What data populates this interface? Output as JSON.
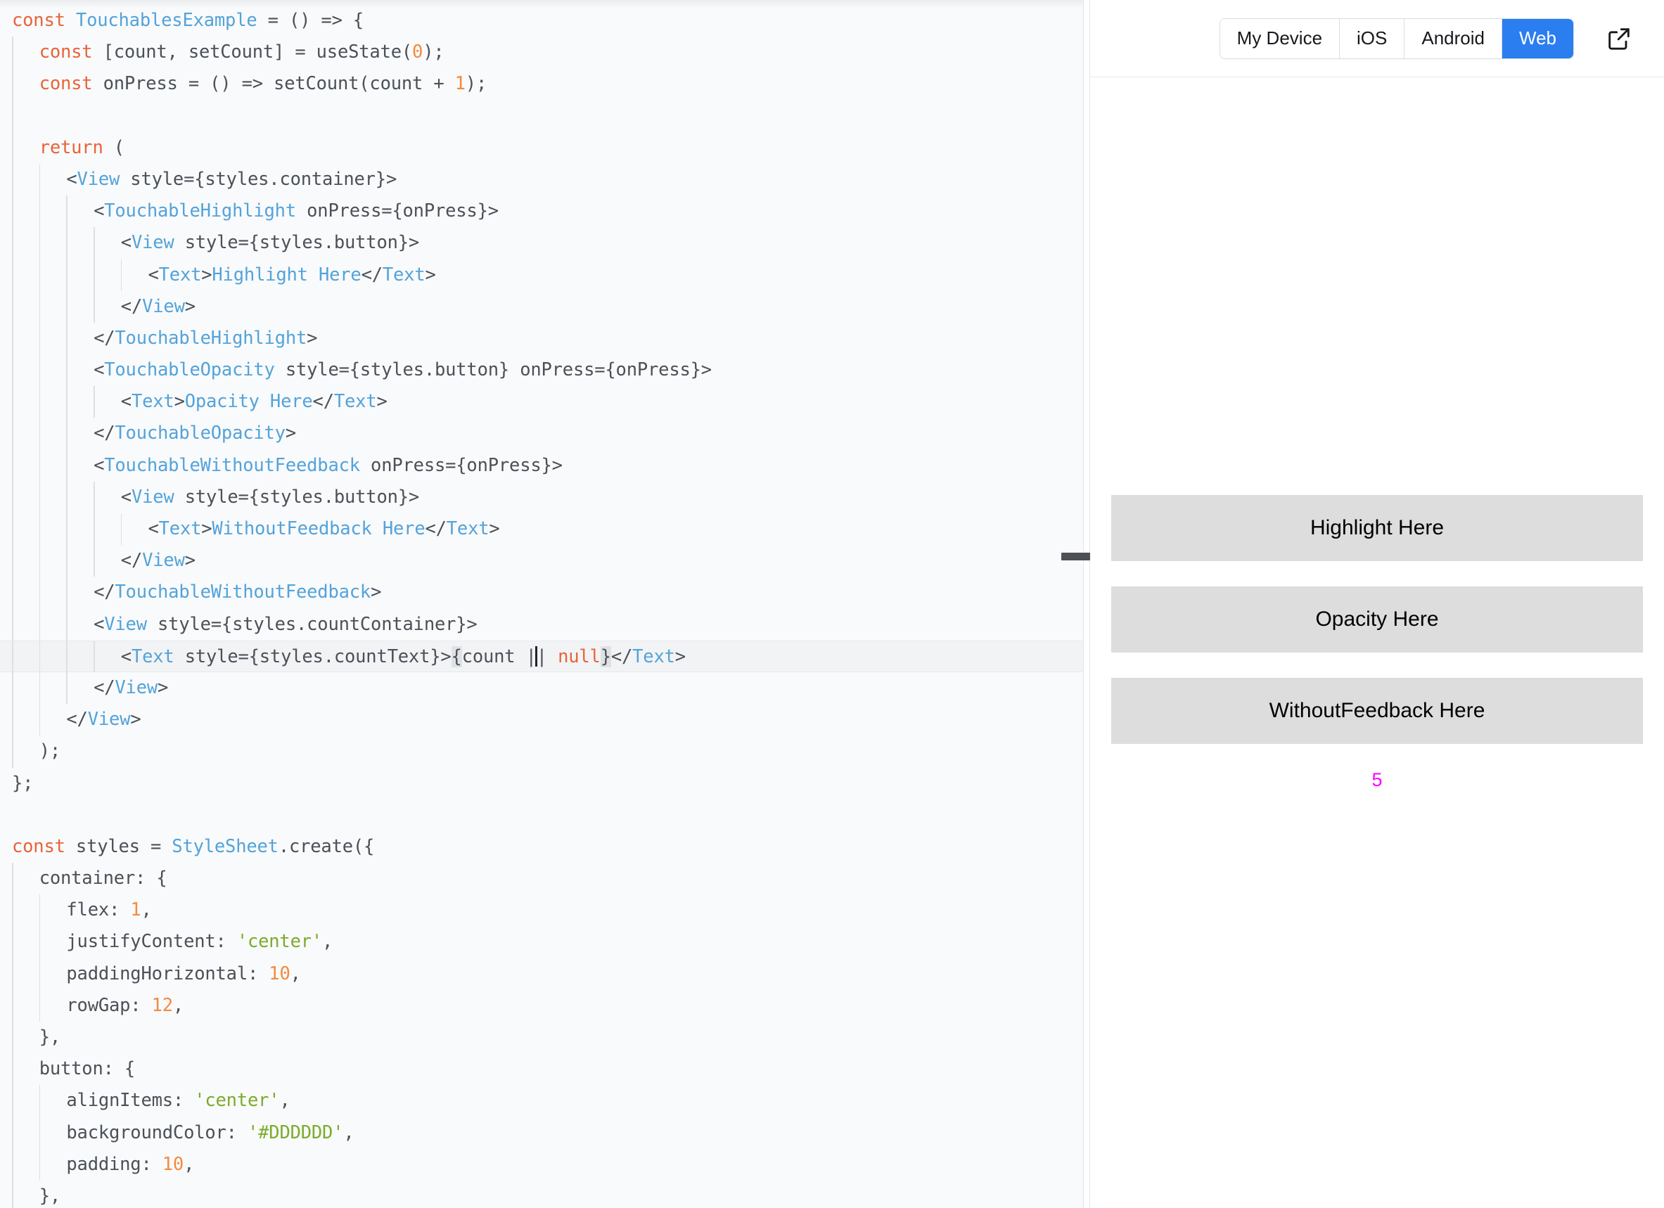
{
  "editor": {
    "active_line_index": 19,
    "lines": [
      {
        "i": 0,
        "indent": 0,
        "guides": 0,
        "tokens": [
          [
            "kw",
            "const"
          ],
          [
            "pl",
            " "
          ],
          [
            "tag",
            "TouchablesExample"
          ],
          [
            "pl",
            " = () => {"
          ]
        ]
      },
      {
        "i": 1,
        "indent": 1,
        "guides": 1,
        "tokens": [
          [
            "kw",
            "const"
          ],
          [
            "pl",
            " [count, setCount] = useState("
          ],
          [
            "num",
            "0"
          ],
          [
            "pl",
            ");"
          ]
        ]
      },
      {
        "i": 2,
        "indent": 1,
        "guides": 1,
        "tokens": [
          [
            "kw",
            "const"
          ],
          [
            "pl",
            " onPress = () => setCount(count + "
          ],
          [
            "num",
            "1"
          ],
          [
            "pl",
            ");"
          ]
        ]
      },
      {
        "i": 3,
        "indent": 1,
        "guides": 1,
        "tokens": []
      },
      {
        "i": 4,
        "indent": 1,
        "guides": 1,
        "tokens": [
          [
            "kw",
            "return"
          ],
          [
            "pl",
            " ("
          ]
        ]
      },
      {
        "i": 5,
        "indent": 2,
        "guides": 2,
        "tokens": [
          [
            "pl",
            "<"
          ],
          [
            "tag",
            "View"
          ],
          [
            "pl",
            " style={styles.container}>"
          ]
        ]
      },
      {
        "i": 6,
        "indent": 3,
        "guides": 3,
        "tokens": [
          [
            "pl",
            "<"
          ],
          [
            "tag",
            "TouchableHighlight"
          ],
          [
            "pl",
            " onPress={onPress}>"
          ]
        ]
      },
      {
        "i": 7,
        "indent": 4,
        "guides": 4,
        "tokens": [
          [
            "pl",
            "<"
          ],
          [
            "tag",
            "View"
          ],
          [
            "pl",
            " style={styles.button}>"
          ]
        ]
      },
      {
        "i": 8,
        "indent": 5,
        "guides": 5,
        "tokens": [
          [
            "pl",
            "<"
          ],
          [
            "tag",
            "Text"
          ],
          [
            "pl",
            ">"
          ],
          [
            "tag",
            "Highlight Here"
          ],
          [
            "pl",
            "</"
          ],
          [
            "tag",
            "Text"
          ],
          [
            "pl",
            ">"
          ]
        ]
      },
      {
        "i": 9,
        "indent": 4,
        "guides": 4,
        "tokens": [
          [
            "pl",
            "</"
          ],
          [
            "tag",
            "View"
          ],
          [
            "pl",
            ">"
          ]
        ]
      },
      {
        "i": 10,
        "indent": 3,
        "guides": 3,
        "tokens": [
          [
            "pl",
            "</"
          ],
          [
            "tag",
            "TouchableHighlight"
          ],
          [
            "pl",
            ">"
          ]
        ]
      },
      {
        "i": 11,
        "indent": 3,
        "guides": 3,
        "tokens": [
          [
            "pl",
            "<"
          ],
          [
            "tag",
            "TouchableOpacity"
          ],
          [
            "pl",
            " style={styles.button} onPress={onPress}>"
          ]
        ]
      },
      {
        "i": 12,
        "indent": 4,
        "guides": 4,
        "tokens": [
          [
            "pl",
            "<"
          ],
          [
            "tag",
            "Text"
          ],
          [
            "pl",
            ">"
          ],
          [
            "tag",
            "Opacity Here"
          ],
          [
            "pl",
            "</"
          ],
          [
            "tag",
            "Text"
          ],
          [
            "pl",
            ">"
          ]
        ]
      },
      {
        "i": 13,
        "indent": 3,
        "guides": 3,
        "tokens": [
          [
            "pl",
            "</"
          ],
          [
            "tag",
            "TouchableOpacity"
          ],
          [
            "pl",
            ">"
          ]
        ]
      },
      {
        "i": 14,
        "indent": 3,
        "guides": 3,
        "tokens": [
          [
            "pl",
            "<"
          ],
          [
            "tag",
            "TouchableWithoutFeedback"
          ],
          [
            "pl",
            " onPress={onPress}>"
          ]
        ]
      },
      {
        "i": 15,
        "indent": 4,
        "guides": 4,
        "tokens": [
          [
            "pl",
            "<"
          ],
          [
            "tag",
            "View"
          ],
          [
            "pl",
            " style={styles.button}>"
          ]
        ]
      },
      {
        "i": 16,
        "indent": 5,
        "guides": 5,
        "tokens": [
          [
            "pl",
            "<"
          ],
          [
            "tag",
            "Text"
          ],
          [
            "pl",
            ">"
          ],
          [
            "tag",
            "WithoutFeedback Here"
          ],
          [
            "pl",
            "</"
          ],
          [
            "tag",
            "Text"
          ],
          [
            "pl",
            ">"
          ]
        ]
      },
      {
        "i": 17,
        "indent": 4,
        "guides": 4,
        "tokens": [
          [
            "pl",
            "</"
          ],
          [
            "tag",
            "View"
          ],
          [
            "pl",
            ">"
          ]
        ]
      },
      {
        "i": 18,
        "indent": 3,
        "guides": 3,
        "tokens": [
          [
            "pl",
            "</"
          ],
          [
            "tag",
            "TouchableWithoutFeedback"
          ],
          [
            "pl",
            ">"
          ]
        ]
      },
      {
        "i": 19,
        "indent": 3,
        "guides": 3,
        "tokens": [
          [
            "pl",
            "<"
          ],
          [
            "tag",
            "View"
          ],
          [
            "pl",
            " style={styles.countContainer}>"
          ]
        ]
      },
      {
        "i": 20,
        "indent": 4,
        "guides": 4,
        "active": true,
        "tokens": [
          [
            "pl",
            "<"
          ],
          [
            "tag",
            "Text"
          ],
          [
            "pl",
            " style={styles.countText}>"
          ],
          [
            "brk",
            "{"
          ],
          [
            "pl",
            "count |"
          ],
          [
            "caret",
            ""
          ],
          [
            "pl",
            "| "
          ],
          [
            "kw",
            "null"
          ],
          [
            "brk",
            "}"
          ],
          [
            "pl",
            "</"
          ],
          [
            "tag",
            "Text"
          ],
          [
            "pl",
            ">"
          ]
        ]
      },
      {
        "i": 21,
        "indent": 3,
        "guides": 3,
        "tokens": [
          [
            "pl",
            "</"
          ],
          [
            "tag",
            "View"
          ],
          [
            "pl",
            ">"
          ]
        ]
      },
      {
        "i": 22,
        "indent": 2,
        "guides": 2,
        "tokens": [
          [
            "pl",
            "</"
          ],
          [
            "tag",
            "View"
          ],
          [
            "pl",
            ">"
          ]
        ]
      },
      {
        "i": 23,
        "indent": 1,
        "guides": 1,
        "tokens": [
          [
            "pl",
            ");"
          ]
        ]
      },
      {
        "i": 24,
        "indent": 0,
        "guides": 0,
        "tokens": [
          [
            "pl",
            "};"
          ]
        ]
      },
      {
        "i": 25,
        "indent": 0,
        "guides": 0,
        "tokens": []
      },
      {
        "i": 26,
        "indent": 0,
        "guides": 0,
        "tokens": [
          [
            "kw",
            "const"
          ],
          [
            "pl",
            " styles = "
          ],
          [
            "tag",
            "StyleSheet"
          ],
          [
            "pl",
            ".create({"
          ]
        ]
      },
      {
        "i": 27,
        "indent": 1,
        "guides": 1,
        "tokens": [
          [
            "pl",
            "container: {"
          ]
        ]
      },
      {
        "i": 28,
        "indent": 2,
        "guides": 2,
        "tokens": [
          [
            "pl",
            "flex: "
          ],
          [
            "num",
            "1"
          ],
          [
            "pl",
            ","
          ]
        ]
      },
      {
        "i": 29,
        "indent": 2,
        "guides": 2,
        "tokens": [
          [
            "pl",
            "justifyContent: "
          ],
          [
            "str",
            "'center'"
          ],
          [
            "pl",
            ","
          ]
        ]
      },
      {
        "i": 30,
        "indent": 2,
        "guides": 2,
        "tokens": [
          [
            "pl",
            "paddingHorizontal: "
          ],
          [
            "num",
            "10"
          ],
          [
            "pl",
            ","
          ]
        ]
      },
      {
        "i": 31,
        "indent": 2,
        "guides": 2,
        "tokens": [
          [
            "pl",
            "rowGap: "
          ],
          [
            "num",
            "12"
          ],
          [
            "pl",
            ","
          ]
        ]
      },
      {
        "i": 32,
        "indent": 1,
        "guides": 1,
        "tokens": [
          [
            "pl",
            "},"
          ]
        ]
      },
      {
        "i": 33,
        "indent": 1,
        "guides": 1,
        "tokens": [
          [
            "pl",
            "button: {"
          ]
        ]
      },
      {
        "i": 34,
        "indent": 2,
        "guides": 2,
        "tokens": [
          [
            "pl",
            "alignItems: "
          ],
          [
            "str",
            "'center'"
          ],
          [
            "pl",
            ","
          ]
        ]
      },
      {
        "i": 35,
        "indent": 2,
        "guides": 2,
        "tokens": [
          [
            "pl",
            "backgroundColor: "
          ],
          [
            "str",
            "'#DDDDDD'"
          ],
          [
            "pl",
            ","
          ]
        ]
      },
      {
        "i": 36,
        "indent": 2,
        "guides": 2,
        "tokens": [
          [
            "pl",
            "padding: "
          ],
          [
            "num",
            "10"
          ],
          [
            "pl",
            ","
          ]
        ]
      },
      {
        "i": 37,
        "indent": 1,
        "guides": 1,
        "tokens": [
          [
            "pl",
            "},"
          ]
        ]
      }
    ]
  },
  "preview": {
    "toolbar": {
      "segments": [
        {
          "label": "My Device",
          "active": false
        },
        {
          "label": "iOS",
          "active": false
        },
        {
          "label": "Android",
          "active": false
        },
        {
          "label": "Web",
          "active": true
        }
      ],
      "open_external_icon": "external-link-icon",
      "active_color": "#2a7ef0"
    },
    "buttons": [
      {
        "label": "Highlight Here"
      },
      {
        "label": "Opacity Here"
      },
      {
        "label": "WithoutFeedback Here"
      }
    ],
    "count_value": "5",
    "count_color": "#ff00ff",
    "button_background": "#DDDDDD"
  },
  "splitter": {
    "handle_name": "resize-handle"
  }
}
